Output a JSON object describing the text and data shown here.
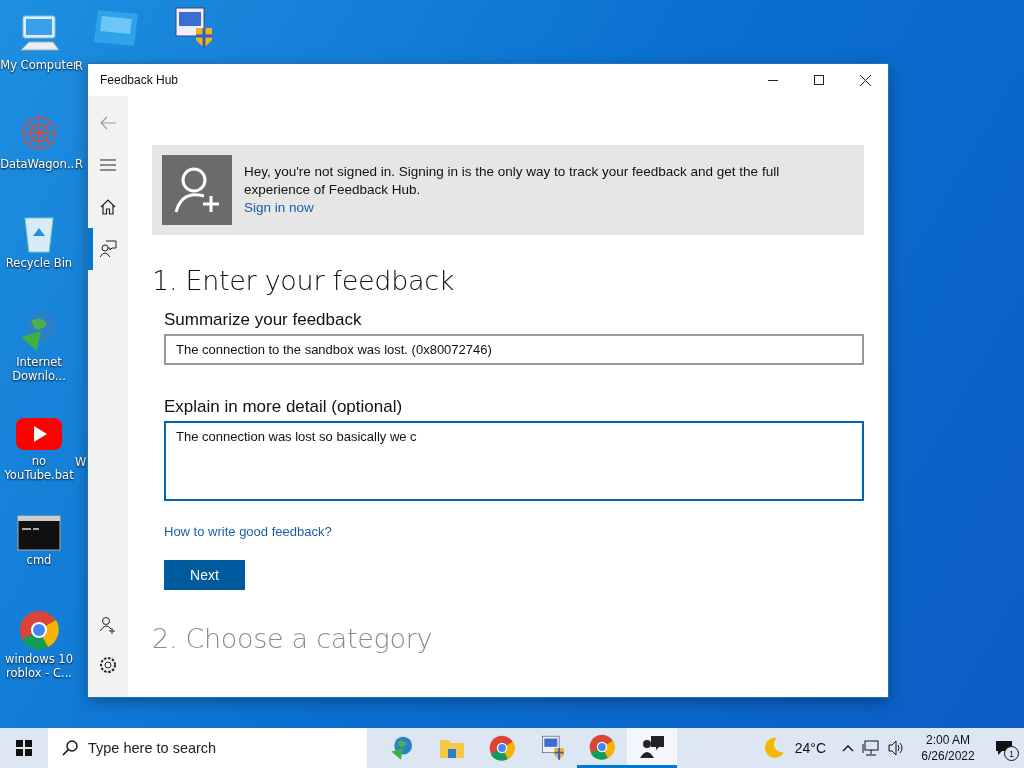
{
  "desktop": {
    "icons": [
      {
        "kind": "computer",
        "label": "My Computer"
      },
      {
        "kind": "network",
        "label": "DataWagon..."
      },
      {
        "kind": "bin",
        "label": "Recycle Bin"
      },
      {
        "kind": "globe",
        "label": "Internet Downlo..."
      },
      {
        "kind": "youtube",
        "label": "no YouTube.bat"
      },
      {
        "kind": "cmd",
        "label": "cmd"
      },
      {
        "kind": "chrome",
        "label": "windows 10 roblox - C..."
      }
    ],
    "column_2_top_icons": [
      {
        "kind": "studio"
      },
      {
        "kind": "setup"
      }
    ],
    "column_2_fragments": [
      "R",
      "R",
      "W"
    ]
  },
  "window": {
    "title": "Feedback Hub",
    "nav": {
      "top": [
        {
          "kind": "back",
          "selected": false
        },
        {
          "kind": "menu",
          "selected": false
        },
        {
          "kind": "home",
          "selected": false
        },
        {
          "kind": "feedback",
          "selected": true
        }
      ],
      "bottom": [
        {
          "kind": "adduser",
          "selected": false
        },
        {
          "kind": "settings",
          "selected": false
        }
      ]
    },
    "banner": {
      "message": "Hey, you're not signed in. Signing in is the only way to track your feedback and get the full experience of Feedback Hub.",
      "link": "Sign in now"
    },
    "step_1": {
      "heading": "1. Enter your feedback",
      "summary": {
        "label": "Summarize your feedback",
        "value": "The connection to the sandbox was lost. (0x80072746)",
        "focused": false
      },
      "detail": {
        "label": "Explain in more detail (optional)",
        "value": "The connection was lost so basically we c",
        "focused": true
      },
      "help_link": "How to write good feedback?",
      "next_button": "Next"
    },
    "step_2": {
      "heading": "2. Choose a category"
    }
  },
  "taskbar": {
    "search": {
      "placeholder": "Type here to search"
    },
    "apps": [
      {
        "kind": "globe",
        "running": false,
        "active": false
      },
      {
        "kind": "folder",
        "running": false,
        "active": false
      },
      {
        "kind": "chrome",
        "running": false,
        "active": false
      },
      {
        "kind": "setup",
        "running": false,
        "active": false
      },
      {
        "kind": "chrome",
        "running": true,
        "active": false
      },
      {
        "kind": "feedback",
        "running": true,
        "active": true
      }
    ],
    "weather": "24°C",
    "clock_time": "2:00 AM",
    "clock_date": "6/26/2022",
    "notification_count": "1"
  }
}
